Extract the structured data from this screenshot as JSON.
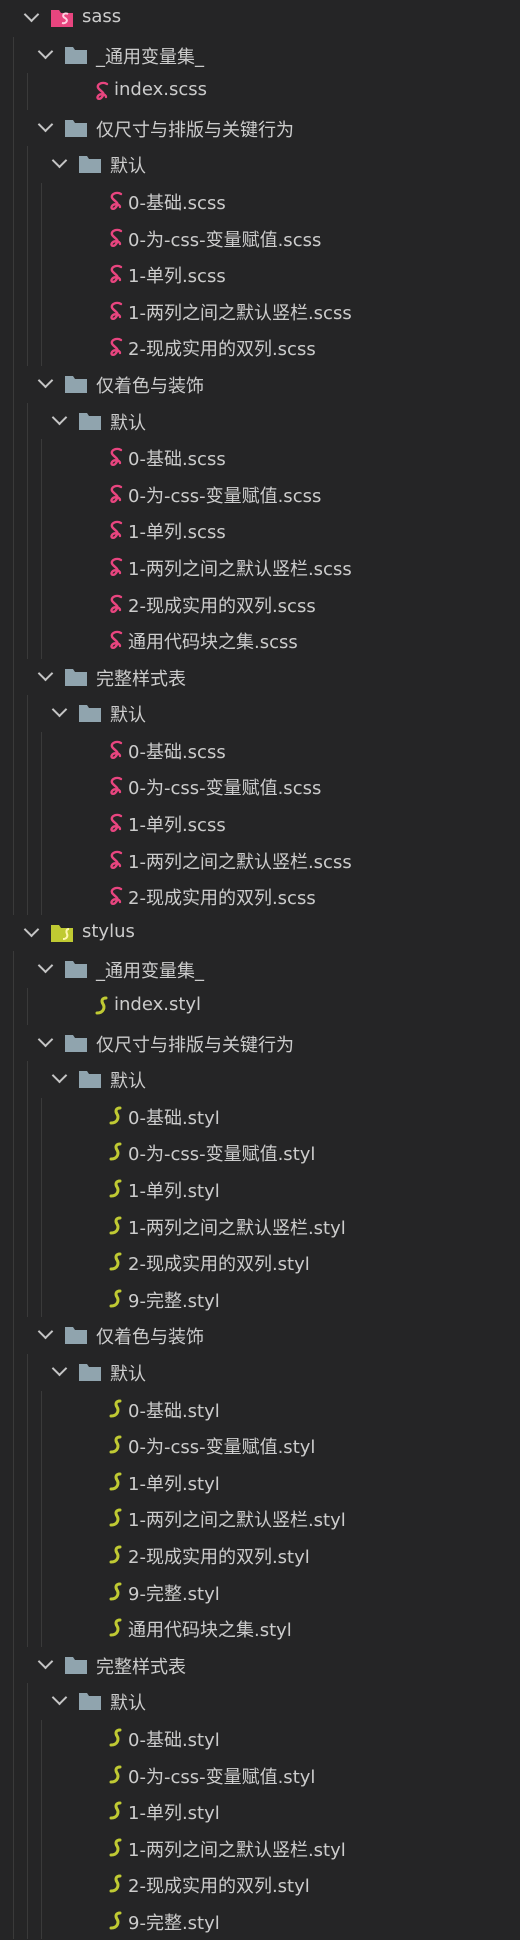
{
  "colors": {
    "background": "#252526",
    "text": "#cccccc",
    "folder": "#90a4ae",
    "sass": "#e8457f",
    "stylus": "#c0ca33"
  },
  "tree": [
    {
      "label": "sass",
      "type": "folder",
      "icon": "sass-folder-icon",
      "children": [
        {
          "label": "_通用变量集_",
          "type": "folder",
          "children": [
            {
              "label": "index.scss",
              "type": "sass"
            }
          ]
        },
        {
          "label": "仅尺寸与排版与关键行为",
          "type": "folder",
          "children": [
            {
              "label": "默认",
              "type": "folder",
              "children": [
                {
                  "label": "0-基础.scss",
                  "type": "sass"
                },
                {
                  "label": "0-为-css-变量赋值.scss",
                  "type": "sass"
                },
                {
                  "label": "1-单列.scss",
                  "type": "sass"
                },
                {
                  "label": "1-两列之间之默认竖栏.scss",
                  "type": "sass"
                },
                {
                  "label": "2-现成实用的双列.scss",
                  "type": "sass"
                }
              ]
            }
          ]
        },
        {
          "label": "仅着色与装饰",
          "type": "folder",
          "children": [
            {
              "label": "默认",
              "type": "folder",
              "children": [
                {
                  "label": "0-基础.scss",
                  "type": "sass"
                },
                {
                  "label": "0-为-css-变量赋值.scss",
                  "type": "sass"
                },
                {
                  "label": "1-单列.scss",
                  "type": "sass"
                },
                {
                  "label": "1-两列之间之默认竖栏.scss",
                  "type": "sass"
                },
                {
                  "label": "2-现成实用的双列.scss",
                  "type": "sass"
                },
                {
                  "label": "通用代码块之集.scss",
                  "type": "sass"
                }
              ]
            }
          ]
        },
        {
          "label": "完整样式表",
          "type": "folder",
          "children": [
            {
              "label": "默认",
              "type": "folder",
              "children": [
                {
                  "label": "0-基础.scss",
                  "type": "sass"
                },
                {
                  "label": "0-为-css-变量赋值.scss",
                  "type": "sass"
                },
                {
                  "label": "1-单列.scss",
                  "type": "sass"
                },
                {
                  "label": "1-两列之间之默认竖栏.scss",
                  "type": "sass"
                },
                {
                  "label": "2-现成实用的双列.scss",
                  "type": "sass"
                }
              ]
            }
          ]
        }
      ]
    },
    {
      "label": "stylus",
      "type": "folder",
      "icon": "stylus-folder-icon",
      "children": [
        {
          "label": "_通用变量集_",
          "type": "folder",
          "children": [
            {
              "label": "index.styl",
              "type": "stylus"
            }
          ]
        },
        {
          "label": "仅尺寸与排版与关键行为",
          "type": "folder",
          "children": [
            {
              "label": "默认",
              "type": "folder",
              "children": [
                {
                  "label": "0-基础.styl",
                  "type": "stylus"
                },
                {
                  "label": "0-为-css-变量赋值.styl",
                  "type": "stylus"
                },
                {
                  "label": "1-单列.styl",
                  "type": "stylus"
                },
                {
                  "label": "1-两列之间之默认竖栏.styl",
                  "type": "stylus"
                },
                {
                  "label": "2-现成实用的双列.styl",
                  "type": "stylus"
                },
                {
                  "label": "9-完整.styl",
                  "type": "stylus"
                }
              ]
            }
          ]
        },
        {
          "label": "仅着色与装饰",
          "type": "folder",
          "children": [
            {
              "label": "默认",
              "type": "folder",
              "children": [
                {
                  "label": "0-基础.styl",
                  "type": "stylus"
                },
                {
                  "label": "0-为-css-变量赋值.styl",
                  "type": "stylus"
                },
                {
                  "label": "1-单列.styl",
                  "type": "stylus"
                },
                {
                  "label": "1-两列之间之默认竖栏.styl",
                  "type": "stylus"
                },
                {
                  "label": "2-现成实用的双列.styl",
                  "type": "stylus"
                },
                {
                  "label": "9-完整.styl",
                  "type": "stylus"
                },
                {
                  "label": "通用代码块之集.styl",
                  "type": "stylus"
                }
              ]
            }
          ]
        },
        {
          "label": "完整样式表",
          "type": "folder",
          "children": [
            {
              "label": "默认",
              "type": "folder",
              "children": [
                {
                  "label": "0-基础.styl",
                  "type": "stylus"
                },
                {
                  "label": "0-为-css-变量赋值.styl",
                  "type": "stylus"
                },
                {
                  "label": "1-单列.styl",
                  "type": "stylus"
                },
                {
                  "label": "1-两列之间之默认竖栏.styl",
                  "type": "stylus"
                },
                {
                  "label": "2-现成实用的双列.styl",
                  "type": "stylus"
                },
                {
                  "label": "9-完整.styl",
                  "type": "stylus"
                }
              ]
            }
          ]
        }
      ]
    }
  ]
}
